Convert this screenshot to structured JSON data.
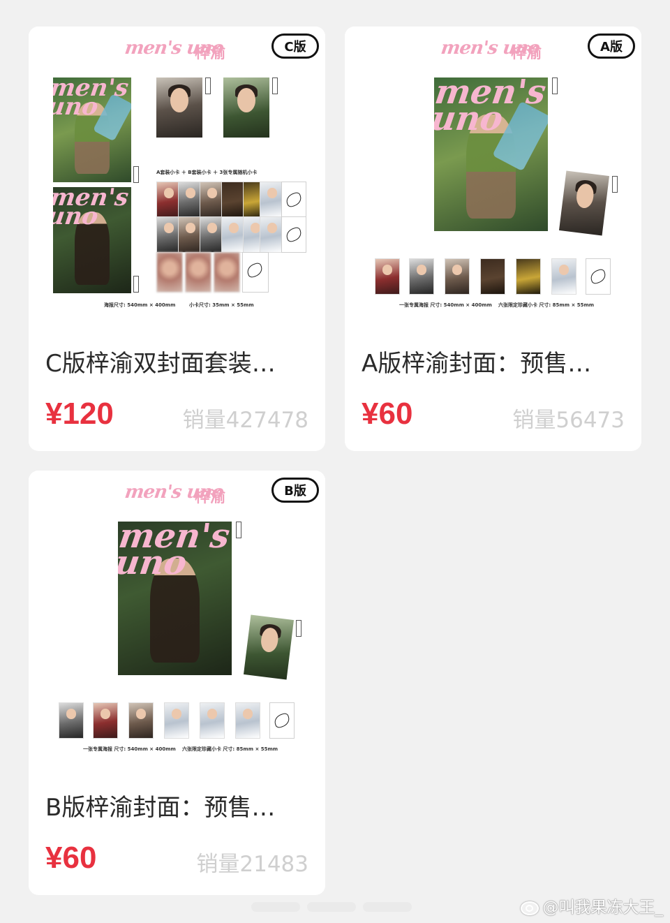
{
  "products": [
    {
      "brand": "men's uno",
      "brand_name": "梓渝",
      "edition": "C版",
      "sheet_line_1": "A套装小卡 ＋ B套装小卡 ＋ 3张专属随机小卡",
      "sheet_line_2": "海报尺寸: 540mm × 400mm",
      "sheet_line_3": "小卡尺寸: 35mm × 55mm",
      "title": "C版梓渝双封面套装…",
      "price": "¥120",
      "sales": "销量427478"
    },
    {
      "brand": "men's uno",
      "brand_name": "梓渝",
      "edition": "A版",
      "sheet_line_2": "一张专属海报  尺寸: 540mm × 400mm",
      "sheet_line_3": "六张限定珍藏小卡  尺寸: 85mm × 55mm",
      "title": "A版梓渝封面：预售…",
      "price": "¥60",
      "sales": "销量56473"
    },
    {
      "brand": "men's uno",
      "brand_name": "梓渝",
      "edition": "B版",
      "sheet_line_2": "一张专属海报  尺寸: 540mm × 400mm",
      "sheet_line_3": "六张限定珍藏小卡  尺寸: 85mm × 55mm",
      "title": "B版梓渝封面：预售…",
      "price": "¥60",
      "sales": "销量21483"
    }
  ],
  "watermark": "@叫我果冻大王_",
  "colors": {
    "price": "#e8313f",
    "brand": "#f2a2bd",
    "sales": "#cfcfcf"
  }
}
